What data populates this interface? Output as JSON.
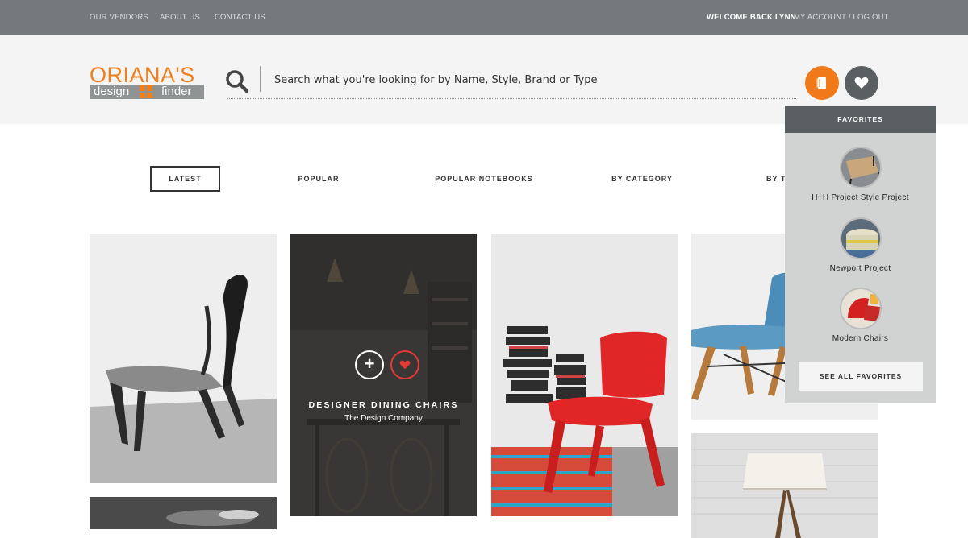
{
  "topbar": {
    "vendors": "OUR VENDORS",
    "about": "ABOUT US",
    "contact": "CONTACT US",
    "welcome": "WELCOME BACK LYNN",
    "account": "MY ACCOUNT / LOG OUT"
  },
  "logo": {
    "top": "ORIANA'S",
    "design": "design",
    "finder": "finder",
    "brand_color": "#f07f1a"
  },
  "search": {
    "placeholder": "Search what you're looking for by Name, Style, Brand or Type"
  },
  "header_buttons": {
    "notebook_icon": "notebook-icon",
    "favorites_icon": "heart-icon",
    "notebook_color": "#f07a1a",
    "favorites_color": "#5a6061"
  },
  "tabs": [
    {
      "label": "LATEST",
      "active": true
    },
    {
      "label": "POPULAR"
    },
    {
      "label": "POPULAR NOTEBOOKS"
    },
    {
      "label": "BY CATEGORY"
    },
    {
      "label": "BY T"
    }
  ],
  "grid": {
    "hover_card": {
      "title": "DESIGNER DINING CHAIRS",
      "subtitle": "The Design Company",
      "add_icon": "plus-icon",
      "favorite_icon": "heart-icon"
    }
  },
  "favorites": {
    "header": "FAVORITES",
    "items": [
      {
        "label": "H+H Project Style Project"
      },
      {
        "label": "Newport Project"
      },
      {
        "label": "Modern Chairs"
      }
    ],
    "see_all": "SEE ALL FAVORITES"
  }
}
